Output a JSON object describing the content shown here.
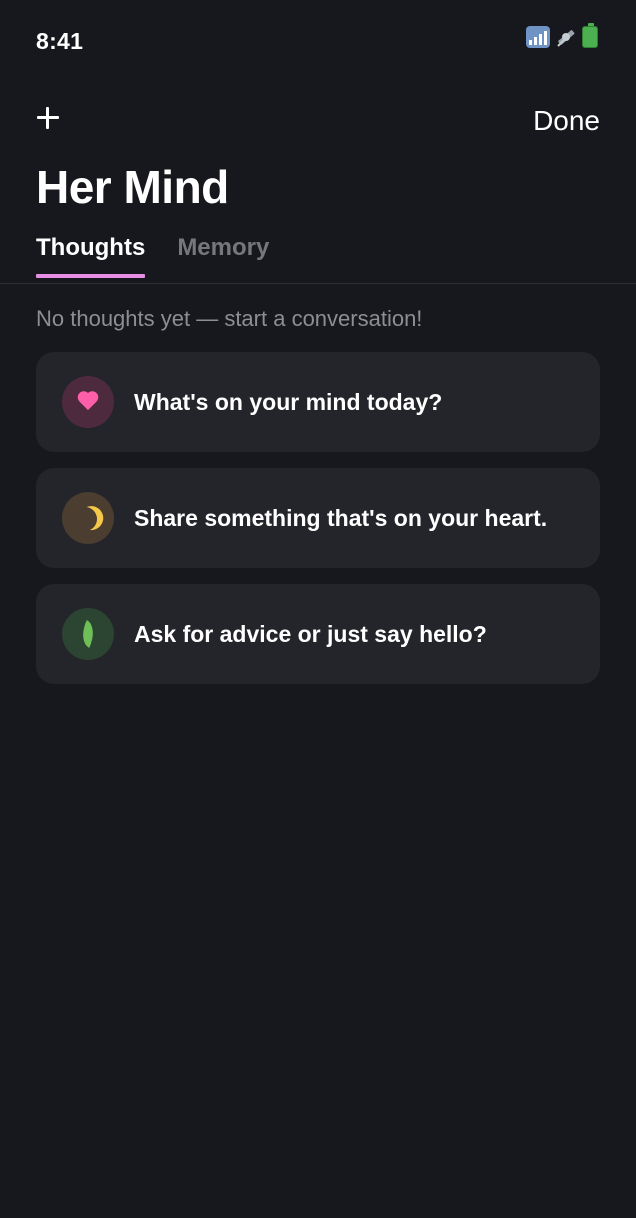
{
  "status_bar": {
    "time": "8:41",
    "icons": [
      "signal-icon",
      "satellite-icon",
      "battery-icon"
    ]
  },
  "header": {
    "add_icon": "plus-icon",
    "done_label": "Done",
    "title": "Her Mind"
  },
  "tabs": [
    {
      "label": "Thoughts",
      "active": true
    },
    {
      "label": "Memory",
      "active": false
    }
  ],
  "main": {
    "empty_message": "No thoughts yet — start a conversation!",
    "suggestions": [
      {
        "icon": "heart-icon",
        "label": "What's on your mind today?"
      },
      {
        "icon": "moon-icon",
        "label": "Share something that's on your heart."
      },
      {
        "icon": "leaf-icon",
        "label": "Ask for advice or just say hello?"
      }
    ]
  },
  "colors": {
    "background": "#17181d",
    "card": "#24252b",
    "tab_indicator": "#e58ee3",
    "inactive_tab": "#76777d",
    "muted_text": "#8d8e94"
  }
}
